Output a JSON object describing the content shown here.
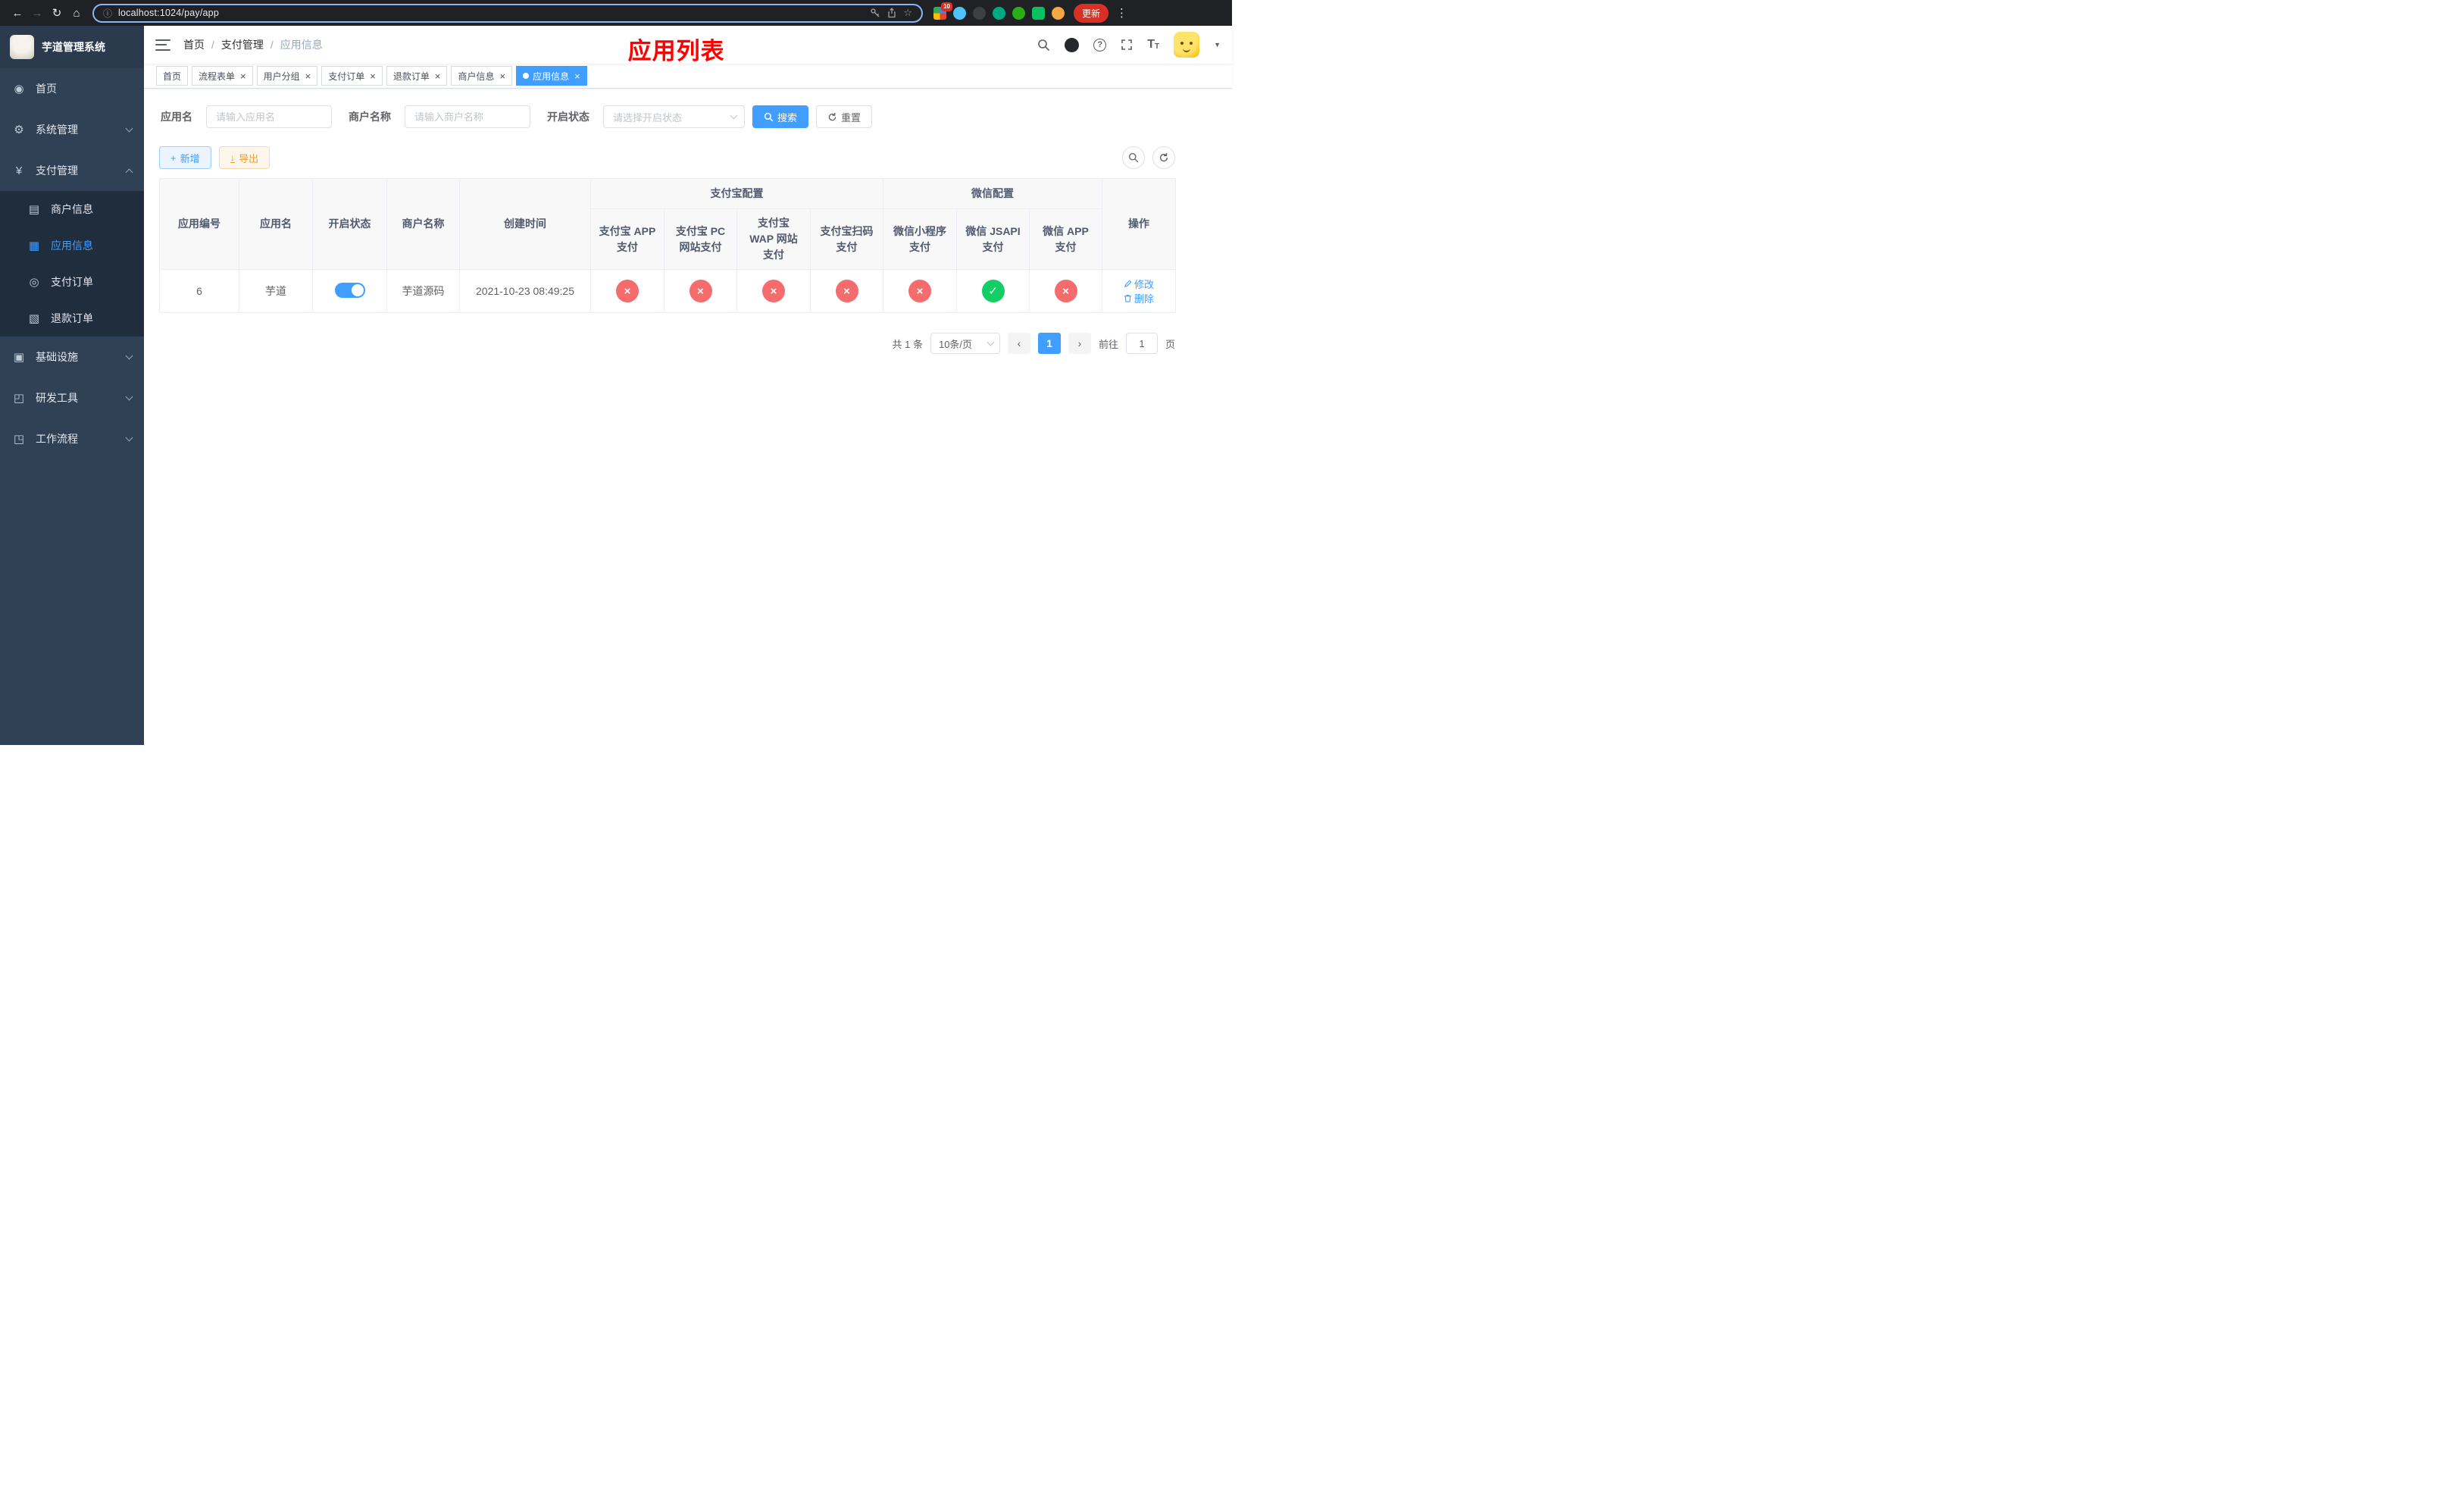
{
  "browser": {
    "url": "localhost:1024/pay/app",
    "update_label": "更新",
    "extension_badge": "10"
  },
  "icons": {
    "back": "←",
    "forward": "→",
    "reload": "↻",
    "home": "⌂",
    "info": "ⓘ",
    "star": "☆",
    "overflow": "⋮",
    "caret_down": "▼",
    "prev": "‹",
    "next": "›",
    "plus": "+",
    "close": "×",
    "question": "?",
    "download": "↓",
    "font_big": "T",
    "font_small": "T",
    "menu_home": "◉",
    "menu_system": "⚙",
    "menu_pay": "¥",
    "menu_merchant": "▤",
    "menu_app": "▦",
    "menu_order": "◎",
    "menu_refund": "▧",
    "menu_infra": "▣",
    "menu_devtool": "◰",
    "menu_workflow": "◳"
  },
  "sidebar": {
    "title": "芋道管理系统",
    "menu": [
      {
        "label": "首页"
      },
      {
        "label": "系统管理"
      },
      {
        "label": "支付管理"
      },
      {
        "label": "基础设施"
      },
      {
        "label": "研发工具"
      },
      {
        "label": "工作流程"
      }
    ],
    "submenu": [
      {
        "label": "商户信息"
      },
      {
        "label": "应用信息"
      },
      {
        "label": "支付订单"
      },
      {
        "label": "退款订单"
      }
    ]
  },
  "navbar": {
    "breadcrumb": [
      "首页",
      "支付管理",
      "应用信息"
    ],
    "breadcrumb_sep": "/",
    "annotation": "应用列表"
  },
  "tabs": [
    {
      "label": "首页"
    },
    {
      "label": "流程表单"
    },
    {
      "label": "用户分组"
    },
    {
      "label": "支付订单"
    },
    {
      "label": "退款订单"
    },
    {
      "label": "商户信息"
    },
    {
      "label": "应用信息"
    }
  ],
  "filters": {
    "app_name_label": "应用名",
    "app_name_placeholder": "请输入应用名",
    "merchant_label": "商户名称",
    "merchant_placeholder": "请输入商户名称",
    "status_label": "开启状态",
    "status_placeholder": "请选择开启状态",
    "search_label": "搜索",
    "reset_label": "重置"
  },
  "toolbar": {
    "add_label": "新增",
    "export_label": "导出"
  },
  "table": {
    "headers": {
      "app_id": "应用编号",
      "app_name": "应用名",
      "status": "开启状态",
      "merchant": "商户名称",
      "created": "创建时间",
      "alipay_group": "支付宝配置",
      "alipay_cols": [
        "支付宝 APP 支付",
        "支付宝 PC 网站支付",
        "支付宝 WAP 网站支付",
        "支付宝扫码支付"
      ],
      "wechat_group": "微信配置",
      "wechat_cols": [
        "微信小程序支付",
        "微信 JSAPI 支付",
        "微信 APP 支付"
      ],
      "actions": "操作"
    },
    "row": {
      "app_id": "6",
      "app_name": "芋道",
      "status_on": true,
      "merchant": "芋道源码",
      "created": "2021-10-23 08:49:25",
      "pay_configs": [
        "fail",
        "fail",
        "fail",
        "fail",
        "fail",
        "ok",
        "fail"
      ],
      "edit_label": "修改",
      "delete_label": "删除"
    }
  },
  "pagination": {
    "total": "共 1 条",
    "page_size": "10条/页",
    "current_page": "1",
    "goto_label": "前往",
    "goto_value": "1",
    "goto_suffix": "页"
  },
  "colors": {
    "primary": "#409eff",
    "success": "#13ce66",
    "danger": "#f56c6c",
    "warning": "#e6a23c",
    "sidebar_bg": "#304156",
    "annotation_red": "#ff0000"
  }
}
